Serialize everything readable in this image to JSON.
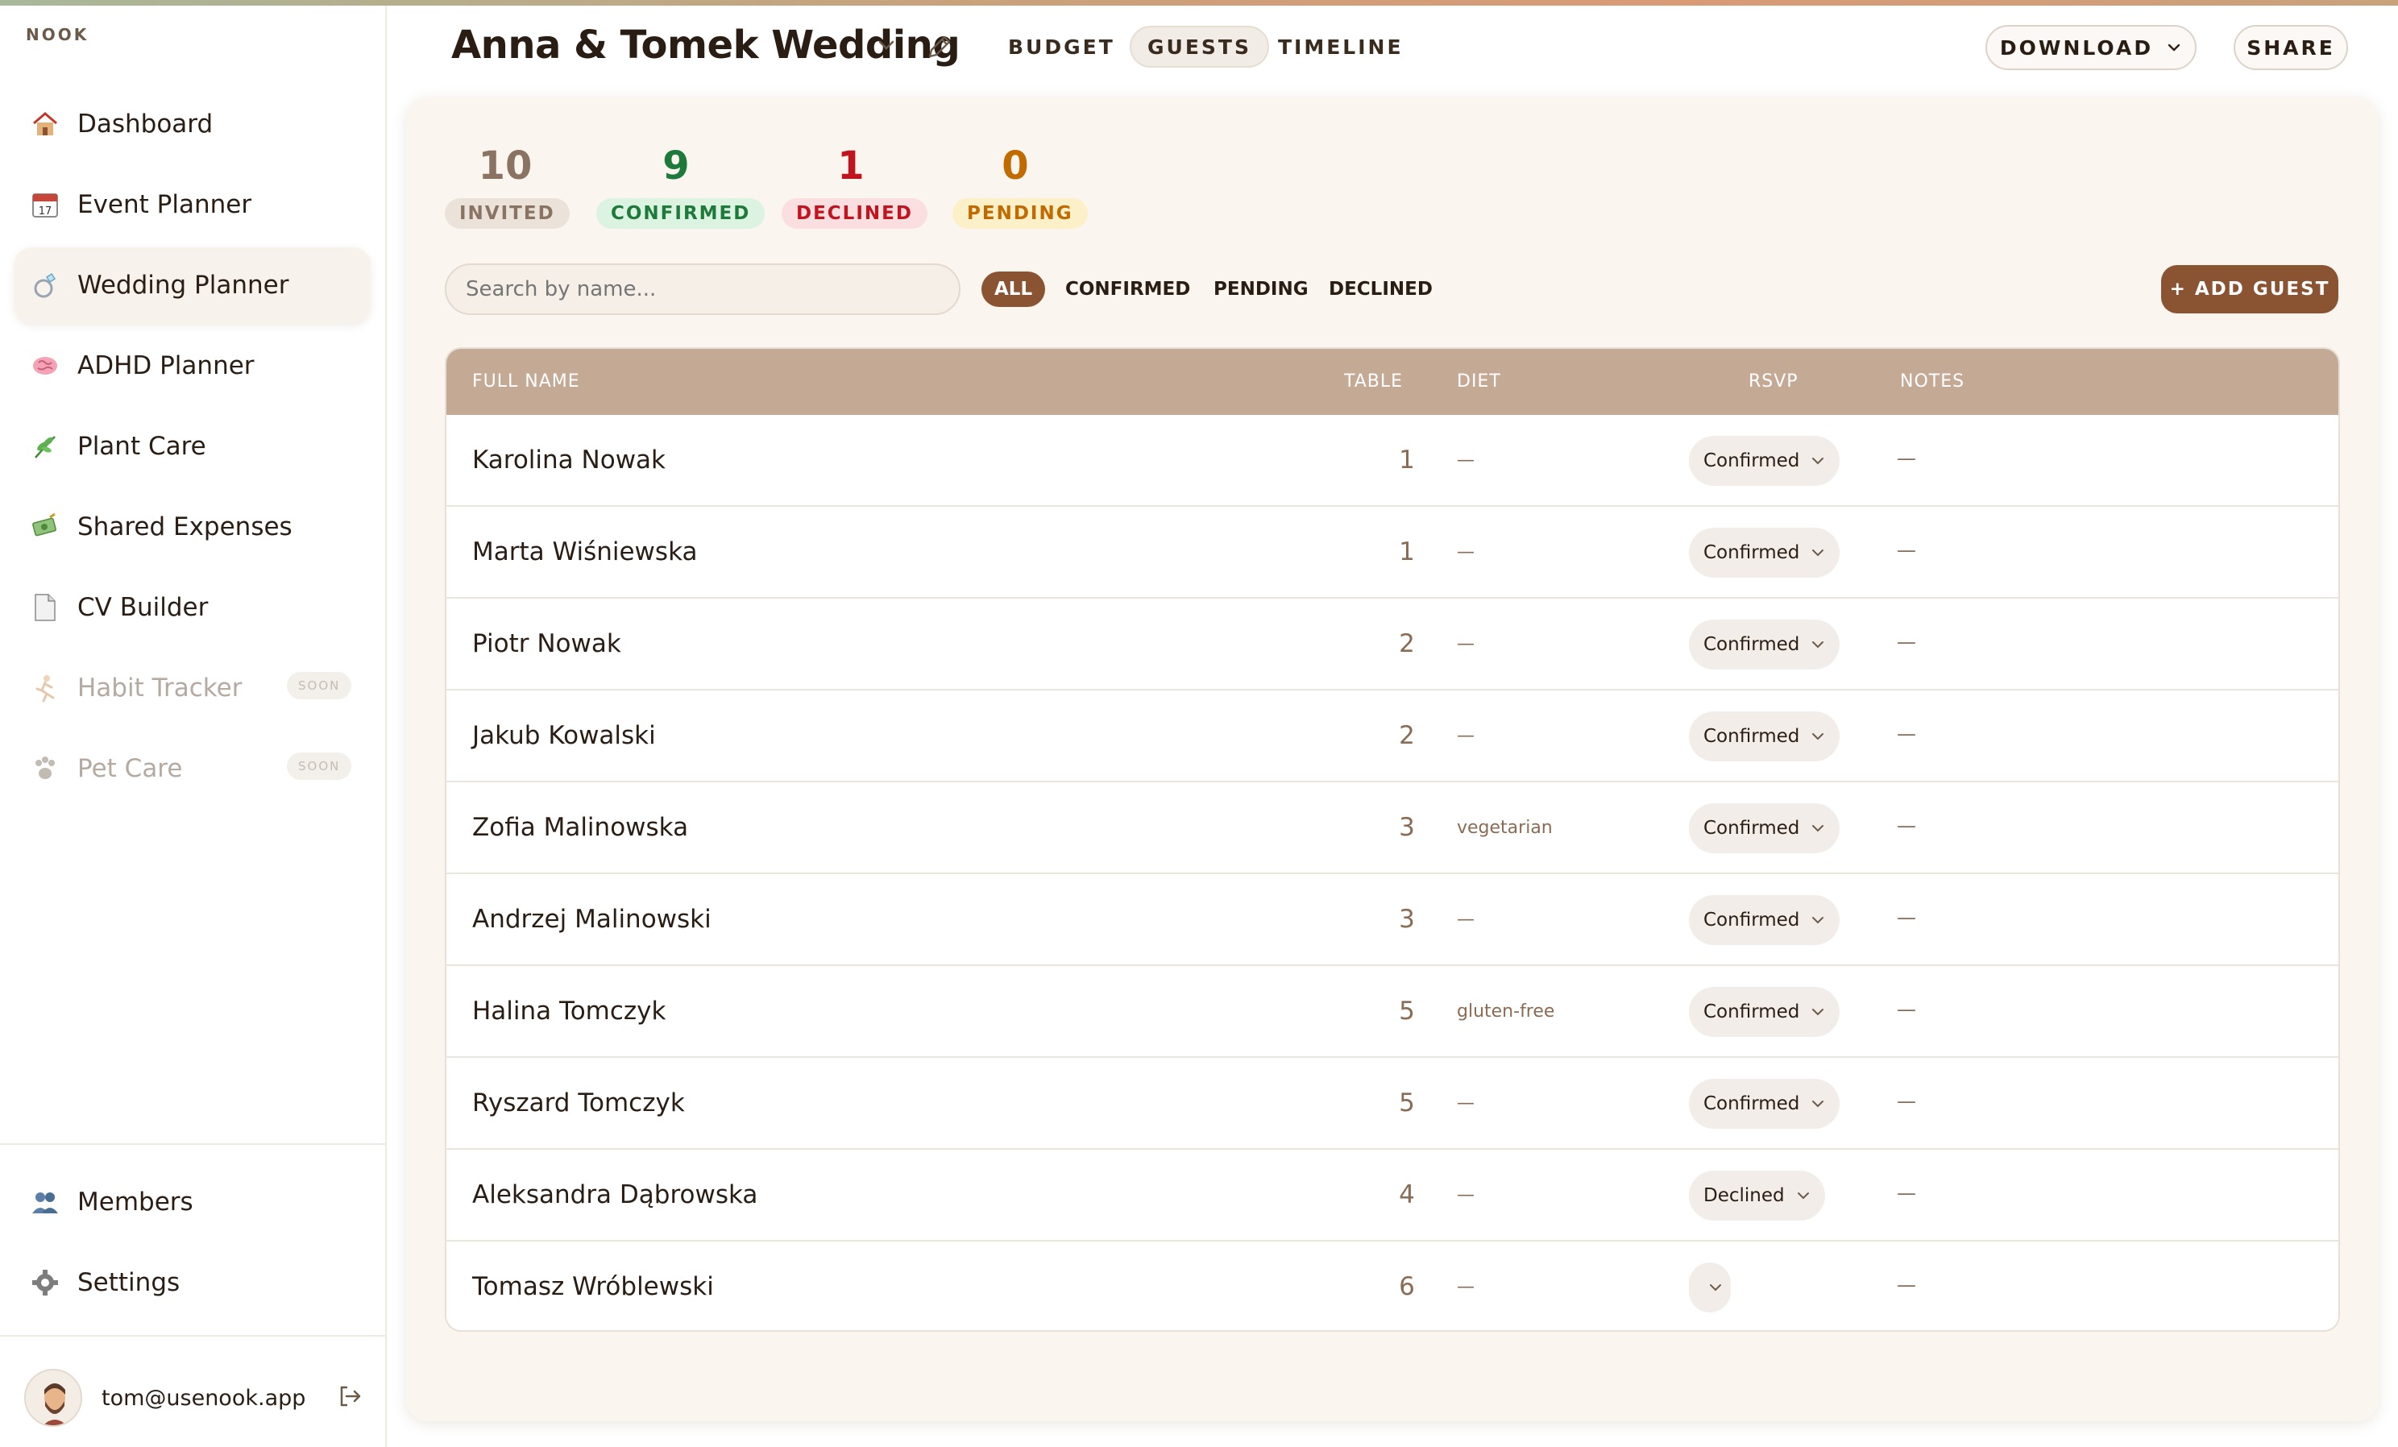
{
  "brand": "NOOK",
  "sidebar": {
    "items": [
      {
        "label": "Dashboard",
        "icon": "house-icon"
      },
      {
        "label": "Event Planner",
        "icon": "calendar-icon"
      },
      {
        "label": "Wedding Planner",
        "icon": "ring-icon"
      },
      {
        "label": "ADHD Planner",
        "icon": "brain-icon"
      },
      {
        "label": "Plant Care",
        "icon": "herb-icon"
      },
      {
        "label": "Shared Expenses",
        "icon": "money-icon"
      },
      {
        "label": "CV Builder",
        "icon": "document-icon"
      },
      {
        "label": "Habit Tracker",
        "icon": "runner-icon",
        "badge": "SOON"
      },
      {
        "label": "Pet Care",
        "icon": "paw-icon",
        "badge": "SOON"
      }
    ],
    "bottom": [
      {
        "label": "Members",
        "icon": "members-icon"
      },
      {
        "label": "Settings",
        "icon": "settings-gear-icon"
      }
    ],
    "user_email": "tom@usenook.app"
  },
  "header": {
    "title": "Anna & Tomek Wedding",
    "tabs": [
      "BUDGET",
      "GUESTS",
      "TIMELINE"
    ],
    "download_label": "DOWNLOAD",
    "share_label": "SHARE"
  },
  "stats": [
    {
      "value": "10",
      "label": "INVITED",
      "color": "#8a7363",
      "bg": "#ebe2da"
    },
    {
      "value": "9",
      "label": "CONFIRMED",
      "color": "#1e7a3a",
      "bg": "#dcf3e2"
    },
    {
      "value": "1",
      "label": "DECLINED",
      "color": "#c0141e",
      "bg": "#fbdfe0"
    },
    {
      "value": "0",
      "label": "PENDING",
      "color": "#c06a00",
      "bg": "#fbf0c8"
    }
  ],
  "search": {
    "placeholder": "Search by name..."
  },
  "filters": [
    "ALL",
    "CONFIRMED",
    "PENDING",
    "DECLINED"
  ],
  "add_guest_label": "+ ADD GUEST",
  "table": {
    "headers": {
      "name": "FULL NAME",
      "table": "TABLE",
      "diet": "DIET",
      "rsvp": "RSVP",
      "notes": "NOTES"
    },
    "rows": [
      {
        "name": "Karolina Nowak",
        "table": "1",
        "diet": "—",
        "rsvp": "Confirmed",
        "notes": "—"
      },
      {
        "name": "Marta Wiśniewska",
        "table": "1",
        "diet": "—",
        "rsvp": "Confirmed",
        "notes": "—"
      },
      {
        "name": "Piotr Nowak",
        "table": "2",
        "diet": "—",
        "rsvp": "Confirmed",
        "notes": "—"
      },
      {
        "name": "Jakub Kowalski",
        "table": "2",
        "diet": "—",
        "rsvp": "Confirmed",
        "notes": "—"
      },
      {
        "name": "Zofia Malinowska",
        "table": "3",
        "diet": "vegetarian",
        "rsvp": "Confirmed",
        "notes": "—"
      },
      {
        "name": "Andrzej Malinowski",
        "table": "3",
        "diet": "—",
        "rsvp": "Confirmed",
        "notes": "—"
      },
      {
        "name": "Halina Tomczyk",
        "table": "5",
        "diet": "gluten-free",
        "rsvp": "Confirmed",
        "notes": "—"
      },
      {
        "name": "Ryszard Tomczyk",
        "table": "5",
        "diet": "—",
        "rsvp": "Confirmed",
        "notes": "—"
      },
      {
        "name": "Aleksandra Dąbrowska",
        "table": "4",
        "diet": "—",
        "rsvp": "Declined",
        "notes": "—"
      },
      {
        "name": "Tomasz Wróblewski",
        "table": "6",
        "diet": "—",
        "rsvp": "",
        "notes": "—"
      }
    ]
  }
}
